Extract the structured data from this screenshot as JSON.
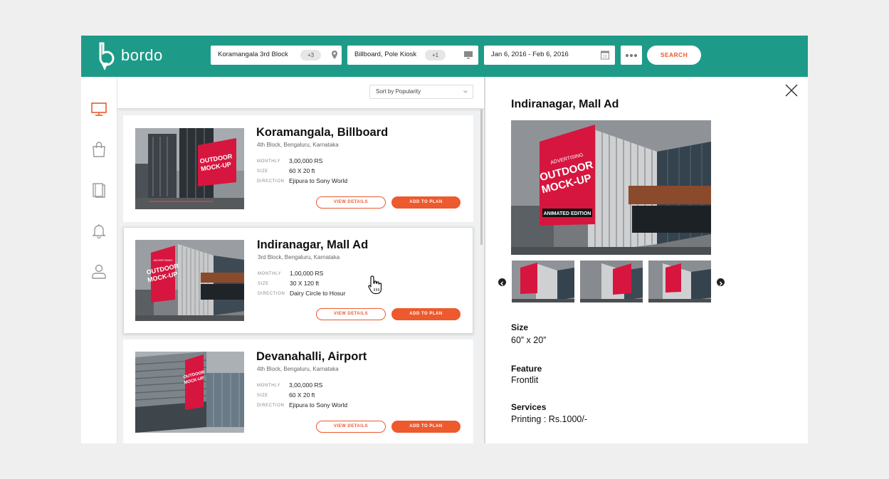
{
  "header": {
    "logo_text": "bordo",
    "location": {
      "value": "Koramangala 3rd Block",
      "extra": "+3"
    },
    "media_type": {
      "value": "Billboard, Pole Kiosk",
      "extra": "+1"
    },
    "dates": {
      "value": "Jan 6, 2016 - Feb 6, 2016",
      "calendar_day": "15"
    },
    "search_label": "SEARCH"
  },
  "sidebar": {
    "items": [
      {
        "icon": "monitor-icon",
        "active": true
      },
      {
        "icon": "bag-icon",
        "active": false
      },
      {
        "icon": "book-icon",
        "active": false
      },
      {
        "icon": "bell-icon",
        "active": false
      },
      {
        "icon": "user-icon",
        "active": false
      }
    ],
    "accent": "#ec5a2e"
  },
  "list": {
    "sort_label": "Sort by Popularity",
    "meta_keys": {
      "monthly": "MONTHLY",
      "size": "SIZE",
      "direction": "DIRECTION"
    },
    "view_label": "VIEW DETAILS",
    "add_label": "ADD TO PLAN",
    "cards": [
      {
        "title": "Koramangala, Billboard",
        "subtitle": "4th Block, Bengaluru, Karnataka",
        "monthly": "3,00,000 RS",
        "size": "60 X 20 ft",
        "direction": "Ejipura to Sony World",
        "billboard_text": [
          "OUTDOOR",
          "MOCK-UP"
        ]
      },
      {
        "title": "Indiranagar, Mall Ad",
        "subtitle": "3rd Block, Bengaluru, Karnataka",
        "monthly": "1,00,000 RS",
        "size": "30 X 120 ft",
        "direction": "Dairy Circle to Hosur",
        "billboard_text": [
          "ADVERTISING",
          "OUTDOOR",
          "MOCK-UP"
        ]
      },
      {
        "title": "Devanahalli, Airport",
        "subtitle": "4th Block, Bengaluru, Karnataka",
        "monthly": "3,00,000 RS",
        "size": "60 X 20 ft",
        "direction": "Ejipura to Sony World",
        "billboard_text": [
          "OUTDOOR",
          "MOCK-UP"
        ]
      }
    ]
  },
  "detail": {
    "title": "Indiranagar, Mall Ad",
    "image_text": [
      "ADVERTISING",
      "OUTDOOR",
      "MOCK-UP",
      "ANIMATED EDITION"
    ],
    "size_label": "Size",
    "size_value": "60” x 20”",
    "feature_label": "Feature",
    "feature_value": "Frontlit",
    "services_label": "Services",
    "services_value": "Printing :  Rs.1000/-"
  },
  "colors": {
    "brand": "#1e9b88",
    "accent": "#ec5a2e",
    "billboard_red": "#d6163f"
  }
}
